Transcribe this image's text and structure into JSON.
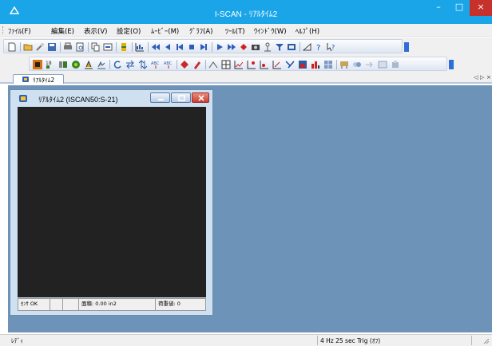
{
  "app": {
    "title": "I-SCAN - ﾘｱﾙﾀｲﾑ2",
    "icon": "app-icon"
  },
  "window_controls": {
    "minimize": "–",
    "maximize": "□",
    "close": "×"
  },
  "menu": {
    "items": [
      "ﾌｧｲﾙ(F)",
      "編集(E)",
      "表示(V)",
      "設定(O)",
      "ﾑｰﾋﾞｰ(M)",
      "ｸﾞﾗﾌ(A)",
      "ﾂｰﾙ(T)",
      "ｳｲﾝﾄﾞｳ(W)",
      "ﾍﾙﾌﾟ(H)"
    ]
  },
  "toolbar1": {
    "icons": [
      "new-file-icon",
      "open-folder-icon",
      "wizard-icon",
      "save-icon",
      "print-icon",
      "print-preview-icon",
      "copy-icon",
      "export-icon",
      "record-icon",
      "chart-icon",
      "rewind-start-icon",
      "step-back-icon",
      "go-start-icon",
      "stop-icon",
      "go-end-icon",
      "play-icon",
      "fast-forward-icon",
      "record-dot-icon",
      "snapshot-icon",
      "network-icon",
      "filter-icon",
      "compare-icon",
      "region-icon",
      "help-icon",
      "context-help-icon"
    ]
  },
  "toolbar2": {
    "icons": [
      "color-map-icon",
      "sensel-grid-icon",
      "peak-icon",
      "center-icon",
      "contour-icon",
      "profile-icon",
      "rotate-icon",
      "swap-icon",
      "flip-icon",
      "sort-desc-icon",
      "sort-asc-icon",
      "diamond-icon",
      "pencil-icon",
      "line-icon",
      "grid-icon",
      "graph-icon",
      "graph-down-icon",
      "graph-up-icon",
      "graph-alt-icon",
      "slice-icon",
      "box-chart-icon",
      "bar-chart-icon",
      "pattern-icon",
      "tool-a-icon",
      "tool-b-icon",
      "tool-c-icon",
      "tool-d-icon",
      "tool-e-icon"
    ]
  },
  "tabs": {
    "active_label": "ﾘｱﾙﾀｲﾑ2",
    "nav_prev": "◁",
    "nav_next": "▷",
    "nav_close": "×"
  },
  "child_window": {
    "title": "ﾘｱﾙﾀｲﾑ2 (ISCAN50:S-21)",
    "status": {
      "sensor": "ｾﾝｻ OK",
      "area_label": "面積: 0.00 in2",
      "load_label": "荷重値: 0"
    }
  },
  "statusbar": {
    "left": "ﾚﾃﾞｨ",
    "right": "4 Hz 25 sec Trig (ｵﾌ)"
  },
  "colors": {
    "titlebar": "#1aa5e8",
    "close_button": "#c7312b",
    "mdi_background": "#6e93b8",
    "canvas": "#222222",
    "child_frame": "#cfe0f1"
  }
}
